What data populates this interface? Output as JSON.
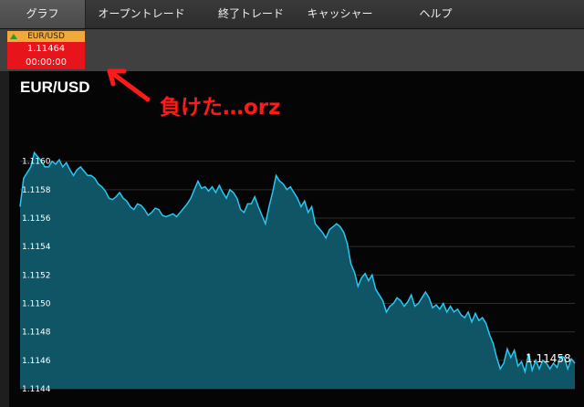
{
  "nav": {
    "tabs": [
      {
        "label": "グラフ",
        "active": true
      },
      {
        "label": "オープントレード",
        "active": false
      },
      {
        "label": "終了トレード",
        "active": false
      },
      {
        "label": "キャッシャー",
        "active": false
      },
      {
        "label": "ヘルプ",
        "active": false
      }
    ]
  },
  "instrument": {
    "pair": "EUR/USD",
    "price": "1.11464",
    "timer": "00:00:00",
    "trend_icon": "up-triangle-icon"
  },
  "chart_title": "EUR/USD",
  "annotation": {
    "text": "負けた…orz",
    "arrow_icon": "arrow-pointing-up-left-icon",
    "color": "#ff1a1a"
  },
  "colors": {
    "line": "#29c6f0",
    "area": "#0f5566",
    "card": "#e8141b",
    "card_header": "#f2a93b"
  },
  "chart_data": {
    "type": "area",
    "title": "EUR/USD",
    "ylim": [
      1.1144,
      1.1162
    ],
    "yticks": [
      "1.1160",
      "1.1158",
      "1.1156",
      "1.1154",
      "1.1152",
      "1.1150",
      "1.1148",
      "1.1146",
      "1.1144"
    ],
    "grid": true,
    "last_value_label": "1.11458",
    "series": [
      {
        "values": [
          1.11568,
          1.11588,
          1.11592,
          1.11596,
          1.11606,
          1.11603,
          1.116,
          1.11596,
          1.11596,
          1.116,
          1.11598,
          1.11601,
          1.11596,
          1.11599,
          1.11594,
          1.1159,
          1.11594,
          1.11596,
          1.11593,
          1.1159,
          1.1159,
          1.11588,
          1.11584,
          1.11582,
          1.11579,
          1.11574,
          1.11573,
          1.11575,
          1.11578,
          1.11574,
          1.11572,
          1.11568,
          1.11566,
          1.1157,
          1.11569,
          1.11566,
          1.11562,
          1.11564,
          1.11567,
          1.11566,
          1.11562,
          1.11561,
          1.11562,
          1.11563,
          1.11561,
          1.11564,
          1.11567,
          1.1157,
          1.11574,
          1.1158,
          1.11586,
          1.11581,
          1.11582,
          1.11579,
          1.11582,
          1.11578,
          1.11583,
          1.11578,
          1.11574,
          1.1158,
          1.11578,
          1.11574,
          1.11566,
          1.11564,
          1.1157,
          1.1157,
          1.11575,
          1.11568,
          1.11562,
          1.11556,
          1.11568,
          1.11578,
          1.1159,
          1.11586,
          1.11584,
          1.1158,
          1.11582,
          1.11578,
          1.11574,
          1.11568,
          1.11572,
          1.11564,
          1.11568,
          1.11556,
          1.11553,
          1.1155,
          1.11546,
          1.11552,
          1.11554,
          1.11556,
          1.11554,
          1.1155,
          1.11542,
          1.11528,
          1.11522,
          1.11512,
          1.11518,
          1.11521,
          1.11516,
          1.1152,
          1.1151,
          1.11506,
          1.11502,
          1.11494,
          1.11498,
          1.115,
          1.11504,
          1.11502,
          1.11498,
          1.11501,
          1.11506,
          1.11498,
          1.115,
          1.11504,
          1.11508,
          1.11504,
          1.11497,
          1.11499,
          1.11496,
          1.115,
          1.11494,
          1.11498,
          1.11494,
          1.11496,
          1.11492,
          1.1149,
          1.11494,
          1.11487,
          1.11493,
          1.11488,
          1.1149,
          1.11486,
          1.11478,
          1.11472,
          1.11462,
          1.11454,
          1.11458,
          1.11468,
          1.11462,
          1.11467,
          1.11456,
          1.11459,
          1.11452,
          1.11465,
          1.11453,
          1.1146,
          1.11454,
          1.1146,
          1.11458,
          1.11454,
          1.11458,
          1.11455,
          1.11463,
          1.11462,
          1.11454,
          1.11461,
          1.11458
        ]
      }
    ]
  }
}
